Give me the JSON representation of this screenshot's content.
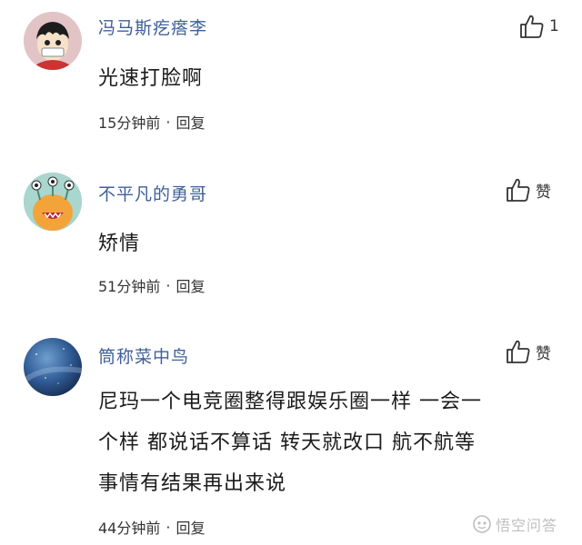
{
  "comments": [
    {
      "username": "冯马斯疙瘩李",
      "content": "光速打脸啊",
      "time": "15分钟前",
      "dot": "·",
      "reply_label": "回复",
      "like_label": "1",
      "avatar_icon": "cartoon-pirate-avatar-icon"
    },
    {
      "username": "不平凡的勇哥",
      "content": "矫情",
      "time": "51分钟前",
      "dot": "·",
      "reply_label": "回复",
      "like_label": "赞",
      "avatar_icon": "monster-avatar-icon"
    },
    {
      "username": "筒称菜中鸟",
      "content_lines": [
        "尼玛一个电竞圈整得跟娱乐圈一样 一会一",
        "个样 都说话不算话 转天就改口 航不航等",
        "事情有结果再出来说"
      ],
      "time": "44分钟前",
      "dot": "·",
      "reply_label": "回复",
      "like_label": "赞",
      "avatar_icon": "night-sky-avatar-icon"
    }
  ],
  "watermark": {
    "text": "悟空问答",
    "icon": "wukong-logo-icon"
  },
  "colors": {
    "username": "#3f5f9a",
    "text": "#1b1b1b",
    "meta": "#333333"
  }
}
